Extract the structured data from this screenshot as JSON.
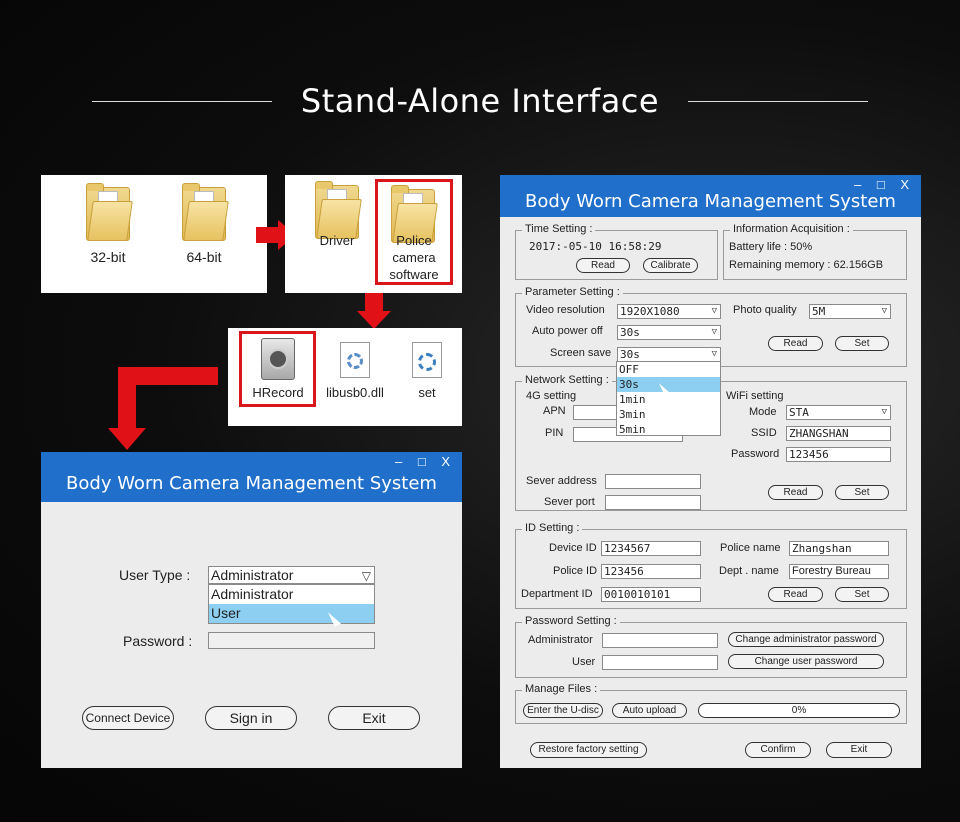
{
  "headline": "Stand-Alone Interface",
  "explorer": {
    "folders": [
      "32-bit",
      "64-bit"
    ],
    "driver_items": [
      "Driver",
      "Police camera software"
    ],
    "exe_items": [
      "HRecord",
      "libusb0.dll",
      "set"
    ]
  },
  "login": {
    "title": "Body Worn Camera Management System",
    "controls": "– □ X",
    "user_type_label": "User Type :",
    "user_type_value": "Administrator",
    "options": [
      "Administrator",
      "User"
    ],
    "password_label": "Password :",
    "password_value": "",
    "buttons": {
      "connect": "Connect Device",
      "signin": "Sign in",
      "exit": "Exit"
    }
  },
  "main": {
    "title": "Body Worn Camera Management System",
    "controls": "– □ X",
    "time": {
      "group": "Time Setting :",
      "value": "2017:-05-10   16:58:29",
      "read": "Read",
      "calibrate": "Calibrate"
    },
    "info": {
      "group": "Information Acquisition :",
      "battery": "Battery life :  50%",
      "memory": "Remaining memory :  62.156GB"
    },
    "param": {
      "group": "Parameter Setting :",
      "video_res_label": "Video resolution",
      "video_res": "1920X1080",
      "photo_q_label": "Photo quality",
      "photo_q": "5M",
      "auto_power_label": "Auto power off",
      "auto_power": "30s",
      "screen_save_label": "Screen save",
      "screen_save": "30s",
      "screen_options": [
        "OFF",
        "30s",
        "1min",
        "3min",
        "5min"
      ],
      "read": "Read",
      "set": "Set"
    },
    "network": {
      "group": "Network Setting :",
      "g4": "4G setting",
      "apn": "APN",
      "pin": "PIN",
      "wifi": "WiFi setting",
      "mode_label": "Mode",
      "mode": "STA",
      "ssid_label": "SSID",
      "ssid": "ZHANGSHAN",
      "pwd_label": "Password",
      "pwd": "123456",
      "server_addr": "Sever address",
      "server_port": "Sever port",
      "read": "Read",
      "set": "Set"
    },
    "id": {
      "group": "ID Setting :",
      "device_id_label": "Device ID",
      "device_id": "1234567",
      "police_name_label": "Police name",
      "police_name": "Zhangshan",
      "police_id_label": "Police ID",
      "police_id": "123456",
      "dept_name_label": "Dept . name",
      "dept_name": "Forestry Bureau",
      "dept_id_label": "Department ID",
      "dept_id": "0010010101",
      "read": "Read",
      "set": "Set"
    },
    "password": {
      "group": "Password Setting :",
      "admin": "Administrator",
      "user": "User",
      "change_admin": "Change administrator password",
      "change_user": "Change user password"
    },
    "files": {
      "group": "Manage Files :",
      "enter": "Enter the U-disc",
      "upload": "Auto upload",
      "progress": "0%"
    },
    "restore": "Restore factory setting",
    "confirm": "Confirm",
    "exit": "Exit"
  }
}
